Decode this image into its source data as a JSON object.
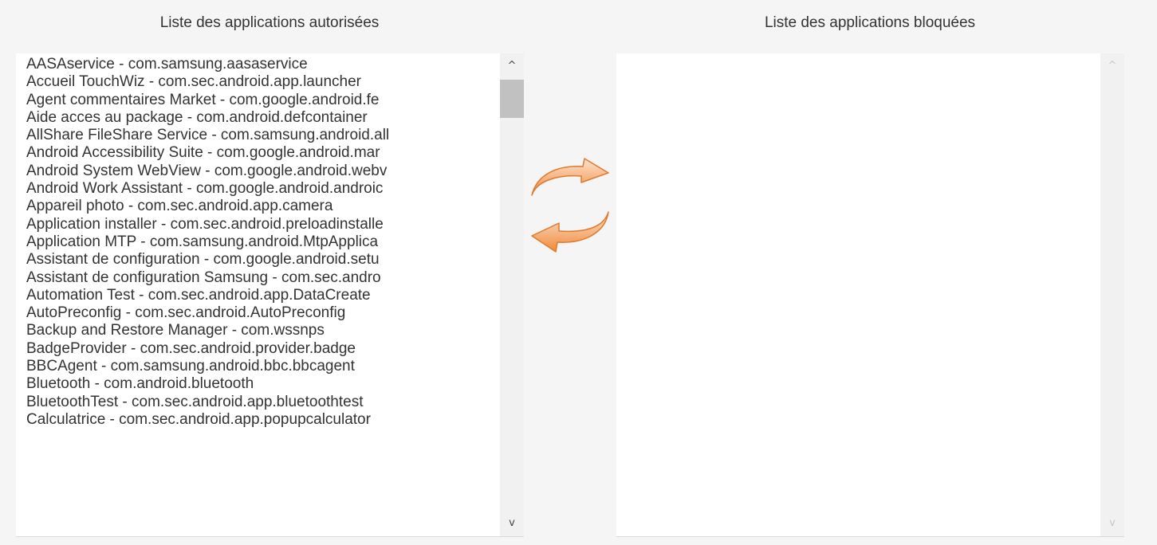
{
  "allowed": {
    "title": "Liste des applications autorisées",
    "items": [
      "AASAservice - com.samsung.aasaservice",
      "Accueil TouchWiz - com.sec.android.app.launcher",
      "Agent commentaires Market - com.google.android.fe",
      "Aide acces au package - com.android.defcontainer",
      "AllShare FileShare Service - com.samsung.android.all",
      "Android Accessibility Suite - com.google.android.mar",
      "Android System WebView - com.google.android.webv",
      "Android Work Assistant - com.google.android.androic",
      "Appareil photo - com.sec.android.app.camera",
      "Application installer - com.sec.android.preloadinstalle",
      "Application MTP - com.samsung.android.MtpApplica",
      "Assistant de configuration - com.google.android.setu",
      "Assistant de configuration Samsung - com.sec.andro",
      "Automation Test - com.sec.android.app.DataCreate",
      "AutoPreconfig - com.sec.android.AutoPreconfig",
      "Backup and Restore Manager - com.wssnps",
      "BadgeProvider - com.sec.android.provider.badge",
      "BBCAgent - com.samsung.android.bbc.bbcagent",
      "Bluetooth - com.android.bluetooth",
      "BluetoothTest - com.sec.android.app.bluetoothtest",
      "Calculatrice - com.sec.android.app.popupcalculator"
    ],
    "scroll_up_glyph": "^",
    "scroll_down_glyph": "v"
  },
  "blocked": {
    "title": "Liste des applications bloquées",
    "items": [],
    "scroll_up_glyph": "^",
    "scroll_down_glyph": "v"
  },
  "icons": {
    "move_right": "arrow-right-icon",
    "move_left": "arrow-left-icon"
  },
  "colors": {
    "arrow_orange": "#f08a3c",
    "arrow_light": "#fde3cf",
    "background": "#f5f5f5",
    "list_background": "#ffffff",
    "scrollbar_track": "#f1f1f1",
    "scrollbar_thumb": "#c1c1c1"
  }
}
